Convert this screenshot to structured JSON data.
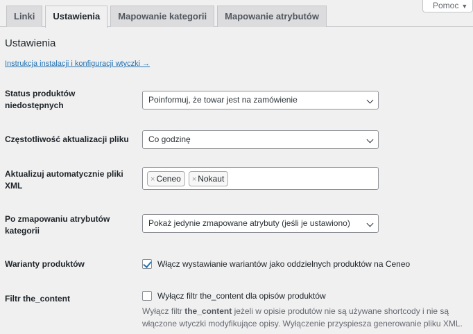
{
  "help_tab": {
    "label": "Pomoc"
  },
  "tabs": [
    {
      "label": "Linki"
    },
    {
      "label": "Ustawienia"
    },
    {
      "label": "Mapowanie kategorii"
    },
    {
      "label": "Mapowanie atrybutów"
    }
  ],
  "active_tab": "Ustawienia",
  "page": {
    "title": "Ustawienia",
    "doc_link": "Instrukcja instalacji i konfiguracji wtyczki →"
  },
  "fields": {
    "stock_status": {
      "label": "Status produktów niedostępnych",
      "value": "Poinformuj, że towar jest na zamówienie"
    },
    "update_frequency": {
      "label": "Częstotliwość aktualizacji pliku",
      "value": "Co godzinę"
    },
    "auto_update": {
      "label": "Aktualizuj automatycznie pliki XML",
      "chips": [
        "Ceneo",
        "Nokaut"
      ]
    },
    "after_mapping": {
      "label": "Po zmapowaniu atrybutów kategorii",
      "value": "Pokaż jedynie zmapowane atrybuty (jeśli je ustawiono)"
    },
    "variants": {
      "label": "Warianty produktów",
      "checkbox_label": "Włącz wystawianie wariantów jako oddzielnych produktów na Ceneo",
      "checked": true
    },
    "the_content": {
      "label": "Filtr the_content",
      "checkbox_label": "Wyłącz filtr the_content dla opisów produktów",
      "checked": false,
      "desc_pre": "Wyłącz filtr ",
      "desc_bold": "the_content",
      "desc_post": " jeżeli w opisie produtów nie są używane shortcody i nie są włączone wtyczki modyfikujące opisy. Wyłączenie przyspiesza generowanie pliku XML."
    }
  },
  "colors": {
    "link": "#2271b1",
    "background": "#f0f0f1",
    "checkbox_check": "#2271b1"
  }
}
